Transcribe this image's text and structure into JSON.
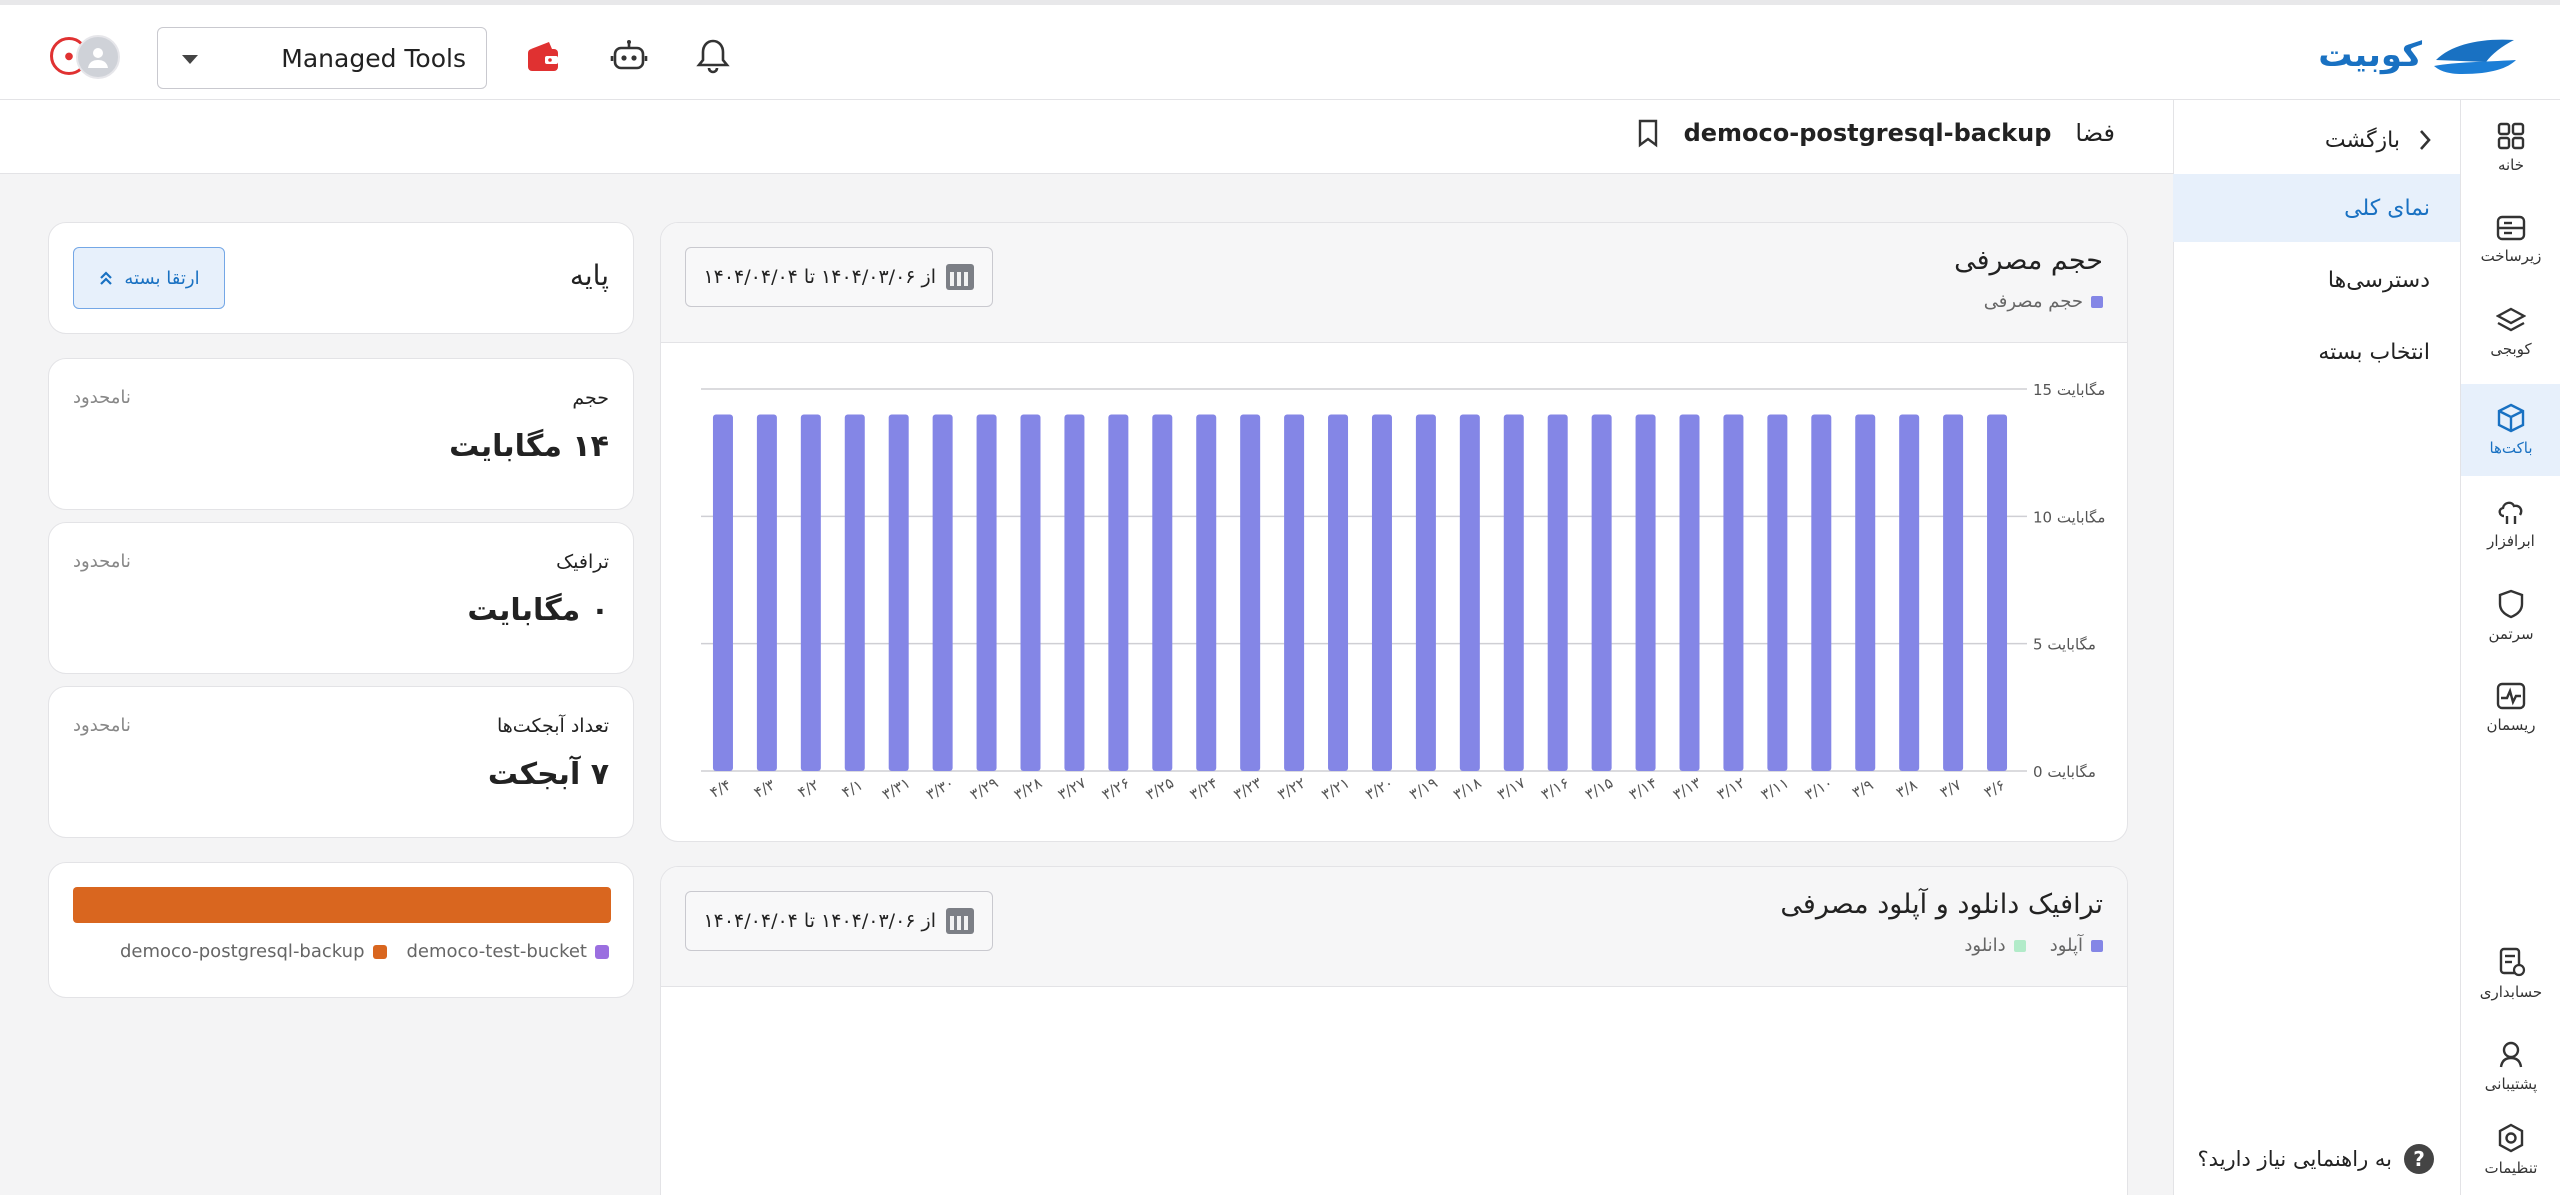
{
  "header": {
    "brand": "کوبیت",
    "project_select": "Managed Tools"
  },
  "rail": {
    "items": [
      {
        "label": "خانه",
        "icon": "grid-icon"
      },
      {
        "label": "زیرساخت",
        "icon": "server-icon"
      },
      {
        "label": "کوبجی",
        "icon": "layers-icon"
      },
      {
        "label": "باکت‌ها",
        "icon": "box-icon",
        "active": true
      },
      {
        "label": "ابرافزار",
        "icon": "cloud-app-icon"
      },
      {
        "label": "سرتمن",
        "icon": "shield-icon"
      },
      {
        "label": "ریسمان",
        "icon": "pulse-icon"
      },
      {
        "label": "حسابداری",
        "icon": "accounting-icon"
      },
      {
        "label": "پشتیبانی",
        "icon": "support-icon"
      },
      {
        "label": "تنظیمات",
        "icon": "settings-icon"
      }
    ]
  },
  "subnav": {
    "back": "بازگشت",
    "items": [
      "نمای کلی",
      "دسترسی‌ها",
      "انتخاب بسته"
    ],
    "help": "به راهنمایی نیاز دارید؟",
    "help_icon": "?"
  },
  "breadcrumb": {
    "section": "فضا",
    "bucket": "democo-postgresql-backup"
  },
  "plan": {
    "name": "پایه",
    "upgrade": "ارتقا بسته"
  },
  "info": [
    {
      "title": "حجم",
      "note": "نامحدود",
      "value": "۱۴ مگابایت"
    },
    {
      "title": "ترافیک",
      "note": "نامحدود",
      "value": "۰ مگابایت"
    },
    {
      "title": "تعداد آبجکت‌ها",
      "note": "نامحدود",
      "value": "۷ آبجکت"
    }
  ],
  "usage": {
    "legend": [
      {
        "label": "democo-test-bucket",
        "color": "#9b6fe0"
      },
      {
        "label": "democo-postgresql-backup",
        "color": "#d9661f"
      }
    ]
  },
  "storage_chart": {
    "title": "حجم مصرفی",
    "legend": "حجم مصرفی",
    "date_range": "از ۱۴۰۴/۰۳/۰۶ تا ۱۴۰۴/۰۴/۰۴"
  },
  "traffic_chart": {
    "title": "ترافیک دانلود و آپلود مصرفی",
    "legend": [
      "آپلود",
      "دانلود"
    ],
    "date_range": "از ۱۴۰۴/۰۳/۰۶ تا ۱۴۰۴/۰۴/۰۴"
  },
  "colors": {
    "accent": "#1971c2",
    "bar": "#8486e6",
    "upload": "#8486e6",
    "download": "#b2ebc9"
  },
  "chart_data": {
    "type": "bar",
    "categories": [
      "۳/۶",
      "۳/۷",
      "۳/۸",
      "۳/۹",
      "۳/۱۰",
      "۳/۱۱",
      "۳/۱۲",
      "۳/۱۳",
      "۳/۱۴",
      "۳/۱۵",
      "۳/۱۶",
      "۳/۱۷",
      "۳/۱۸",
      "۳/۱۹",
      "۳/۲۰",
      "۳/۲۱",
      "۳/۲۲",
      "۳/۲۳",
      "۳/۲۴",
      "۳/۲۵",
      "۳/۲۶",
      "۳/۲۷",
      "۳/۲۸",
      "۳/۲۹",
      "۳/۳۰",
      "۳/۳۱",
      "۴/۱",
      "۴/۲",
      "۴/۳",
      "۴/۴"
    ],
    "series": [
      {
        "name": "حجم مصرفی",
        "values": [
          14,
          14,
          14,
          14,
          14,
          14,
          14,
          14,
          14,
          14,
          14,
          14,
          14,
          14,
          14,
          14,
          14,
          14,
          14,
          14,
          14,
          14,
          14,
          14,
          14,
          14,
          14,
          14,
          14,
          14
        ]
      }
    ],
    "y_ticks": [
      "0 مگابایت",
      "5 مگابایت",
      "10 مگابایت",
      "15 مگابایت"
    ],
    "ylim": [
      0,
      15
    ],
    "grid": true,
    "title": "حجم مصرفی"
  }
}
